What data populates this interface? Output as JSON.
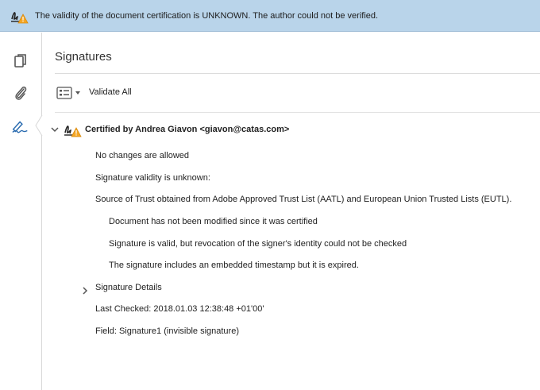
{
  "banner": {
    "message": "The validity of the document certification is UNKNOWN. The author could not be verified.",
    "icon": "signature-warning-icon"
  },
  "rail": {
    "items": [
      {
        "name": "pages-icon"
      },
      {
        "name": "attachment-icon"
      },
      {
        "name": "signature-panel-icon",
        "active": true
      }
    ]
  },
  "panel": {
    "title": "Signatures",
    "validate_all_label": "Validate All"
  },
  "signature": {
    "title": "Certified by Andrea Giavon <giavon@catas.com>",
    "lines": [
      "No changes are allowed",
      "Signature validity is unknown:",
      "Source of Trust obtained from Adobe Approved Trust List (AATL) and European Union Trusted Lists (EUTL)."
    ],
    "sublines": [
      "Document has not been modified since it was certified",
      "Signature is valid, but revocation of the signer's identity could not be checked",
      "The signature includes an embedded timestamp but it is expired."
    ],
    "details_label": "Signature Details",
    "last_checked": "Last Checked: 2018.01.03 12:38:48 +01'00'",
    "field": "Field: Signature1 (invisible signature)"
  },
  "colors": {
    "banner_bg": "#b9d4ea",
    "warning": "#f5a623",
    "accent": "#2b6cb0"
  }
}
